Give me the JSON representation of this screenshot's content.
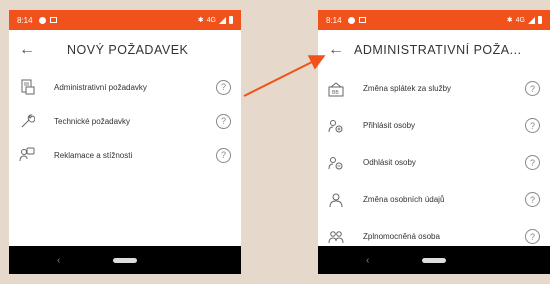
{
  "status": {
    "time": "8:14",
    "net": "4G"
  },
  "left": {
    "title": "NOVÝ POŽADAVEK",
    "items": [
      {
        "label": "Administrativní požadavky",
        "icon": "document-icon"
      },
      {
        "label": "Technické požadavky",
        "icon": "wrench-icon"
      },
      {
        "label": "Reklamace a stížnosti",
        "icon": "complaint-icon"
      }
    ]
  },
  "right": {
    "title": "ADMINISTRATIVNÍ POŽA...",
    "items": [
      {
        "label": "Změna splátek za služby",
        "icon": "payment-icon"
      },
      {
        "label": "Přihlásit osoby",
        "icon": "person-add-icon"
      },
      {
        "label": "Odhlásit osoby",
        "icon": "person-remove-icon"
      },
      {
        "label": "Změna osobních údajů",
        "icon": "person-icon"
      },
      {
        "label": "Zplnomocněná osoba",
        "icon": "persons-icon"
      }
    ]
  },
  "help_glyph": "?",
  "colors": {
    "accent": "#f1511b",
    "background": "#e6d9cc"
  }
}
